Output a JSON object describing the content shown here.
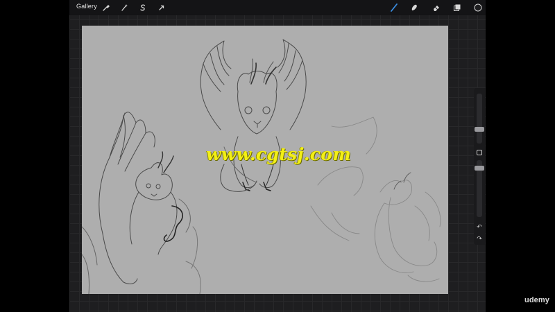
{
  "toolbar": {
    "gallery_label": "Gallery",
    "left_tools": [
      {
        "icon": "wrench-icon",
        "name": "actions"
      },
      {
        "icon": "magic-wand-icon",
        "name": "adjustments"
      },
      {
        "icon": "selection-s-icon",
        "name": "selection"
      },
      {
        "icon": "arrow-cursor-icon",
        "name": "transform"
      }
    ],
    "right_tools": [
      {
        "icon": "brush-icon",
        "name": "paint",
        "active": true
      },
      {
        "icon": "smudge-icon",
        "name": "smudge"
      },
      {
        "icon": "eraser-icon",
        "name": "eraser"
      },
      {
        "icon": "layers-icon",
        "name": "layers"
      },
      {
        "icon": "color-circle-icon",
        "name": "color"
      }
    ]
  },
  "sidebar": {
    "brush_size_level": 0.42,
    "opacity_level": 0.65,
    "icons": [
      "modify-square-icon",
      "undo-icon",
      "redo-icon"
    ]
  },
  "watermark_text": "www.cgtsj.com",
  "brand_text": "udemy",
  "colors": {
    "canvas": "#aeaeae",
    "app_bg": "#1e1e20",
    "toolbar": "#141416",
    "active_brush": "#3a8de0",
    "watermark": "#f3ef16"
  }
}
